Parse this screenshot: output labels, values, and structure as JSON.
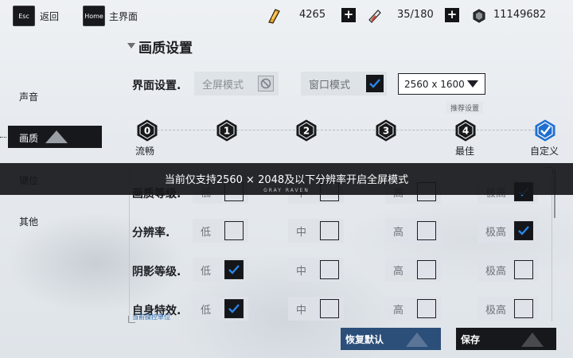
{
  "topbar": {
    "esc_key": "Esc",
    "back_label": "返回",
    "home_key": "Home",
    "home_label": "主界面",
    "resources": [
      {
        "icon": "gold-bar-icon",
        "value": "4265"
      },
      {
        "icon": "stamina-battery-icon",
        "value": "35/180"
      },
      {
        "icon": "coin-icon",
        "value": "11149682"
      }
    ]
  },
  "sidebar": {
    "items": [
      {
        "label": "声音"
      },
      {
        "label": "画质"
      },
      {
        "label": "键位"
      },
      {
        "label": "其他"
      }
    ],
    "active": "画质"
  },
  "section": {
    "title": "画质设置"
  },
  "interface": {
    "label": "界面设置.",
    "fullscreen_label": "全屏模式",
    "fullscreen_enabled": false,
    "windowed_label": "窗口模式",
    "windowed_checked": true,
    "resolution_value": "2560 x 1600",
    "recommend_label": "推荐设置"
  },
  "presets": [
    {
      "num": "0",
      "label": "流畅"
    },
    {
      "num": "1",
      "label": ""
    },
    {
      "num": "2",
      "label": ""
    },
    {
      "num": "3",
      "label": ""
    },
    {
      "num": "4",
      "label": "最佳"
    },
    {
      "num": "",
      "label": "自定义",
      "selected": true
    }
  ],
  "banner": {
    "message": "当前仅支持2560 × 2048及以下分辨率开启全屏模式",
    "sub": "GRAY RAVEN"
  },
  "quality_rows": [
    {
      "label": "画质等级.",
      "options": [
        "低",
        "中",
        "高",
        "极高"
      ],
      "checked": "极高"
    },
    {
      "label": "分辨率.",
      "options": [
        "低",
        "中",
        "高",
        "极高"
      ],
      "checked": "极高"
    },
    {
      "label": "阴影等级.",
      "options": [
        "低",
        "中",
        "高",
        "极高"
      ],
      "checked": "低"
    },
    {
      "label": "自身特效.",
      "sub": "当前操控单位",
      "options": [
        "低",
        "中",
        "高",
        "极高"
      ],
      "checked": "低"
    }
  ],
  "buttons": {
    "reset_label": "恢复默认",
    "save_label": "保存"
  },
  "colors": {
    "accent_blue": "#1f6fd0",
    "dark": "#16181b",
    "reset_button": "#2c4f7a"
  }
}
